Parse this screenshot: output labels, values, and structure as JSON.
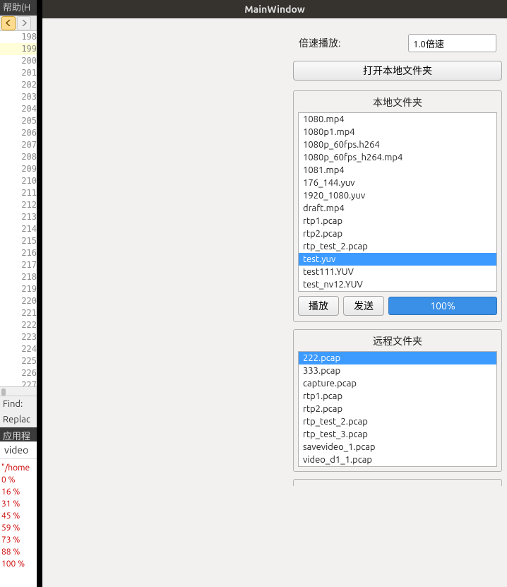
{
  "editor": {
    "menu_help": "帮助(H",
    "line_start": 198,
    "line_end": 227,
    "linehl": 199,
    "find_label": "Find:",
    "replace_label": "Replac",
    "app_section": "应用程",
    "output_title": "video",
    "output_lines": [
      "\"/home",
      "0 %",
      "16 %",
      "31 %",
      "45 %",
      "59 %",
      "73 %",
      "88 %",
      "100 %"
    ]
  },
  "mainwin": {
    "title": "MainWindow",
    "speed_label": "倍速播放:",
    "speed_value": "1.0倍速",
    "open_folder": "打开本地文件夹",
    "local_title": "本地文件夹",
    "local_files": [
      "1080.mp4",
      "1080p1.mp4",
      "1080p_60fps.h264",
      "1080p_60fps_h264.mp4",
      "1081.mp4",
      "176_144.yuv",
      "1920_1080.yuv",
      "draft.mp4",
      "rtp1.pcap",
      "rtp2.pcap",
      "rtp_test_2.pcap",
      "test.yuv",
      "test111.YUV",
      "test_nv12.YUV"
    ],
    "local_selected": "test.yuv",
    "play_btn": "播放",
    "send_btn": "发送",
    "progress_pct": "100%",
    "remote_title": "远程文件夹",
    "remote_files": [
      "222.pcap",
      "333.pcap",
      "capture.pcap",
      "rtp1.pcap",
      "rtp2.pcap",
      "rtp_test_2.pcap",
      "rtp_test_3.pcap",
      "savevideo_1.pcap",
      "video_d1_1.pcap"
    ],
    "remote_selected": "222.pcap"
  }
}
